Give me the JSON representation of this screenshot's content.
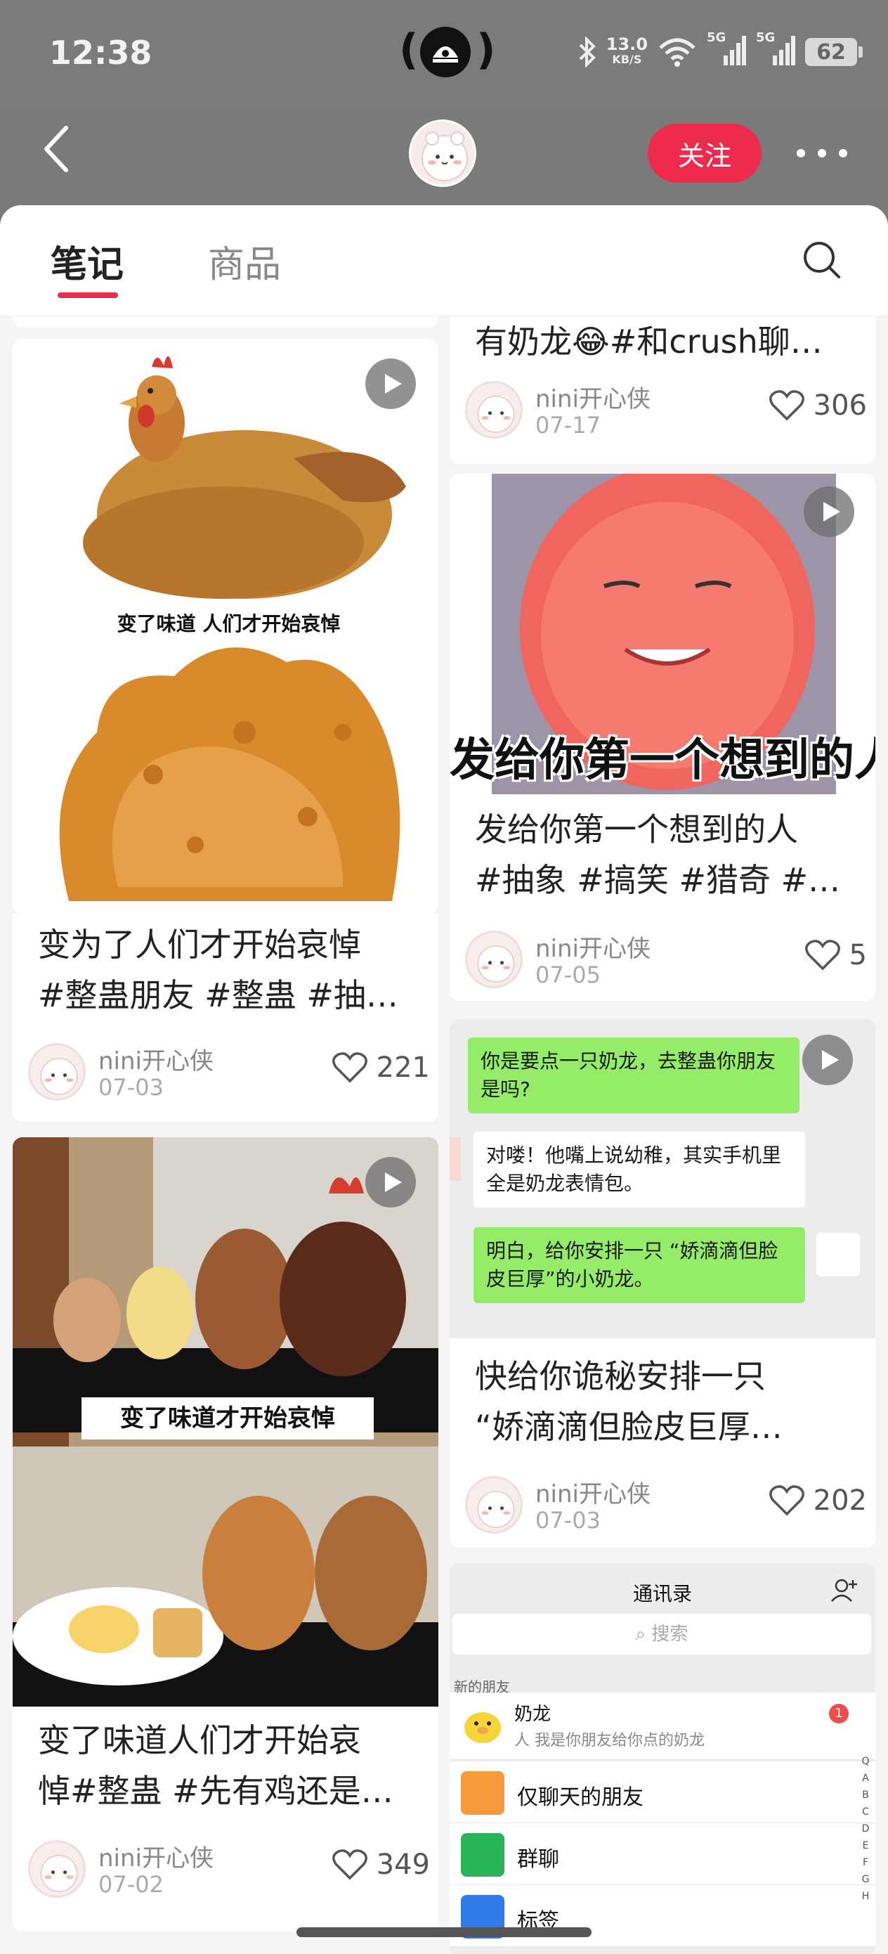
{
  "status_bar": {
    "time": "12:38",
    "speed_value": "13.0",
    "speed_unit": "KB/S",
    "signal1": "5G",
    "signal2": "5G",
    "battery": "62"
  },
  "header": {
    "follow_label": "关注"
  },
  "tabs": [
    {
      "label": "笔记"
    },
    {
      "label": "商品"
    }
  ],
  "left_column": [
    {
      "title_line1": "变为了人们才开始哀悼",
      "title_line2": "#整蛊朋友 #整蛊 #抽…",
      "author": "nini开心侠",
      "date": "07-03",
      "likes": "221",
      "image_caption": "变了味道 人们才开始哀悼"
    },
    {
      "title_line1": "变了味道人们才开始哀",
      "title_line2": "悼#整蛊 #先有鸡还是…",
      "author": "nini开心侠",
      "date": "07-02",
      "likes": "349",
      "image_caption": "变了味道才开始哀悼"
    }
  ],
  "right_column": [
    {
      "title_line1": "有奶龙😂#和crush聊…",
      "author": "nini开心侠",
      "date": "07-17",
      "likes": "306"
    },
    {
      "title_line1": "发给你第一个想到的人",
      "title_line2": "#抽象 #搞笑 #猎奇 #…",
      "author": "nini开心侠",
      "date": "07-05",
      "likes": "5",
      "image_caption": "发给你第一个想到的人"
    },
    {
      "title_line1": "快给你诡秘安排一只",
      "title_line2": "“娇滴滴但脸皮巨厚…",
      "author": "nini开心侠",
      "date": "07-03",
      "likes": "202",
      "chat": [
        "你是要点一只奶龙，去整蛊你朋友是吗?",
        "对喽！他嘴上说幼稚，其实手机里全是奶龙表情包。",
        "明白，给你安排一只 “娇滴滴但脸皮巨厚”的小奶龙。"
      ]
    },
    {
      "contacts_title": "通讯录",
      "search_placeholder": "搜索",
      "new_friends_label": "新的朋友",
      "friend_name": "奶龙",
      "friend_msg": "人 我是你朋友给你点的奶龙",
      "badge": "1",
      "rows": [
        "仅聊天的朋友",
        "群聊",
        "标签"
      ],
      "index_letters": [
        "Q",
        "A",
        "B",
        "C",
        "D",
        "E",
        "F",
        "G",
        "H"
      ]
    }
  ],
  "colors": {
    "accent": "#ee2a4d",
    "chat_green": "#95ec69"
  }
}
